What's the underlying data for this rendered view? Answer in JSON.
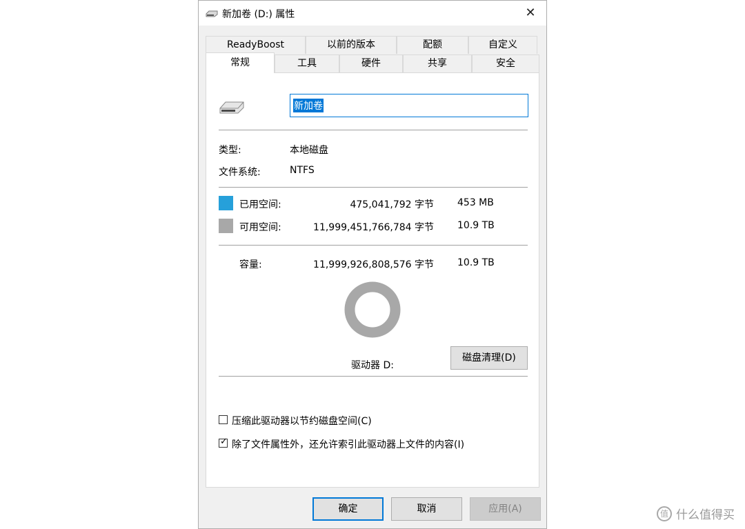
{
  "window": {
    "title": "新加卷 (D:) 属性",
    "close_glyph": "✕"
  },
  "tabs_row1": [
    "ReadyBoost",
    "以前的版本",
    "配额",
    "自定义"
  ],
  "tabs_row2": [
    "常规",
    "工具",
    "硬件",
    "共享",
    "安全"
  ],
  "volume": {
    "name": "新加卷"
  },
  "info": {
    "type_label": "类型:",
    "type_value": "本地磁盘",
    "fs_label": "文件系统:",
    "fs_value": "NTFS"
  },
  "space": {
    "used_label": "已用空间:",
    "used_bytes": "475,041,792 字节",
    "used_size": "453 MB",
    "used_color": "#26a0da",
    "free_label": "可用空间:",
    "free_bytes": "11,999,451,766,784 字节",
    "free_size": "10.9 TB",
    "free_color": "#a8a8a8",
    "cap_label": "容量:",
    "cap_bytes": "11,999,926,808,576 字节",
    "cap_size": "10.9 TB",
    "used_fraction": 4e-05
  },
  "drive": {
    "label": "驱动器 D:",
    "cleanup_button": "磁盘清理(D)"
  },
  "options": {
    "compress": {
      "label": "压缩此驱动器以节约磁盘空间(C)",
      "checked": false
    },
    "index": {
      "label": "除了文件属性外，还允许索引此驱动器上文件的内容(I)",
      "checked": true
    }
  },
  "buttons": {
    "ok": "确定",
    "cancel": "取消",
    "apply": "应用(A)"
  },
  "watermark": {
    "text": "什么值得买",
    "logo": "值"
  }
}
